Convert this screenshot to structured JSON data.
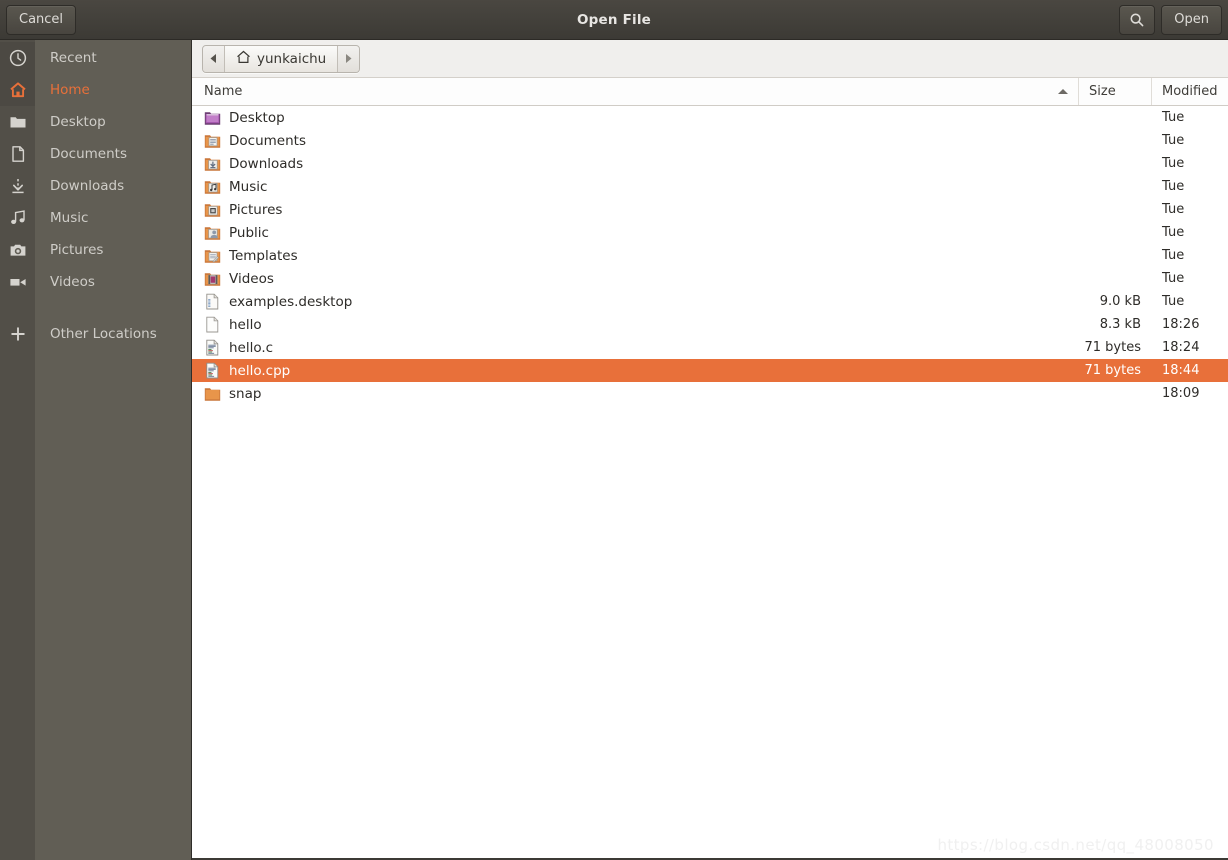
{
  "window": {
    "title": "Open File",
    "cancel_label": "Cancel",
    "open_label": "Open",
    "search_icon": "search-icon"
  },
  "sidebar": {
    "items": [
      {
        "label": "Recent",
        "icon": "clock-icon",
        "active": false
      },
      {
        "label": "Home",
        "icon": "home-icon",
        "active": true
      },
      {
        "label": "Desktop",
        "icon": "folder-icon",
        "active": false
      },
      {
        "label": "Documents",
        "icon": "document-icon",
        "active": false
      },
      {
        "label": "Downloads",
        "icon": "download-icon",
        "active": false
      },
      {
        "label": "Music",
        "icon": "music-icon",
        "active": false
      },
      {
        "label": "Pictures",
        "icon": "camera-icon",
        "active": false
      },
      {
        "label": "Videos",
        "icon": "video-icon",
        "active": false
      },
      {
        "label": "Other Locations",
        "icon": "plus-icon",
        "active": false
      }
    ]
  },
  "pathbar": {
    "back_icon": "chevron-left-icon",
    "forward_icon": "chevron-right-icon",
    "crumb_icon": "home-icon",
    "crumb_label": "yunkaichu"
  },
  "columns": {
    "name": "Name",
    "size": "Size",
    "modified": "Modified",
    "sort_column": "name",
    "sort_direction": "ascending",
    "sort_icon": "triangle-up-icon"
  },
  "files": [
    {
      "name": "Desktop",
      "icon": "folder-desktop-icon",
      "size": "",
      "modified": "Tue",
      "selected": false
    },
    {
      "name": "Documents",
      "icon": "folder-documents-icon",
      "size": "",
      "modified": "Tue",
      "selected": false
    },
    {
      "name": "Downloads",
      "icon": "folder-downloads-icon",
      "size": "",
      "modified": "Tue",
      "selected": false
    },
    {
      "name": "Music",
      "icon": "folder-music-icon",
      "size": "",
      "modified": "Tue",
      "selected": false
    },
    {
      "name": "Pictures",
      "icon": "folder-pictures-icon",
      "size": "",
      "modified": "Tue",
      "selected": false
    },
    {
      "name": "Public",
      "icon": "folder-public-icon",
      "size": "",
      "modified": "Tue",
      "selected": false
    },
    {
      "name": "Templates",
      "icon": "folder-templates-icon",
      "size": "",
      "modified": "Tue",
      "selected": false
    },
    {
      "name": "Videos",
      "icon": "folder-videos-icon",
      "size": "",
      "modified": "Tue",
      "selected": false
    },
    {
      "name": "examples.desktop",
      "icon": "text-file-icon",
      "size": "9.0 kB",
      "modified": "Tue",
      "selected": false
    },
    {
      "name": "hello",
      "icon": "blank-file-icon",
      "size": "8.3 kB",
      "modified": "18:26",
      "selected": false
    },
    {
      "name": "hello.c",
      "icon": "source-file-icon",
      "size": "71 bytes",
      "modified": "18:24",
      "selected": false
    },
    {
      "name": "hello.cpp",
      "icon": "source-file-icon",
      "size": "71 bytes",
      "modified": "18:44",
      "selected": true
    },
    {
      "name": "snap",
      "icon": "folder-plain-icon",
      "size": "",
      "modified": "18:09",
      "selected": false
    }
  ],
  "watermark": {
    "text": "https://blog.csdn.net/qq_48008050"
  },
  "colors": {
    "selection": "#e8703a",
    "accent": "#e8703a",
    "titlebar": "#3c3a35",
    "sidebar": "#615e55",
    "sidebar_iconstrip": "#524f48"
  }
}
